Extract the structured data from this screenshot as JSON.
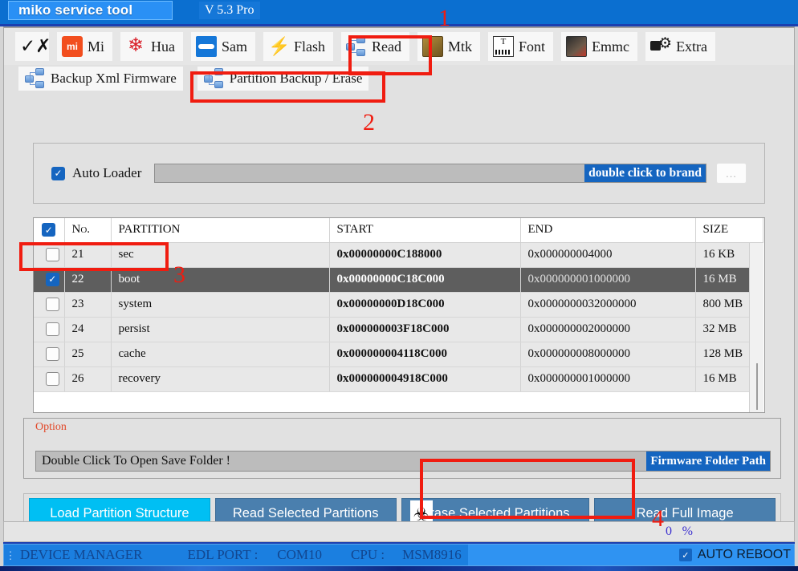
{
  "titlebar": {
    "app_name": "miko service tool",
    "version": "V 5.3 Pro",
    "accent": "#0b6fd0"
  },
  "toolbar": {
    "items": [
      {
        "label": "",
        "icon": "wrench-icon"
      },
      {
        "label": "Mi",
        "icon": "xiaomi-logo-icon"
      },
      {
        "label": "Hua",
        "icon": "huawei-logo-icon"
      },
      {
        "label": "Sam",
        "icon": "samsung-logo-icon"
      },
      {
        "label": "Flash",
        "icon": "lightning-icon"
      },
      {
        "label": "Read",
        "icon": "database-read-icon"
      },
      {
        "label": "Mtk",
        "icon": "mtk-chip-icon"
      },
      {
        "label": "Font",
        "icon": "font-file-icon"
      },
      {
        "label": "Emmc",
        "icon": "emmc-chip-icon"
      },
      {
        "label": "Extra",
        "icon": "extra-tools-icon"
      }
    ],
    "active": "Read"
  },
  "subtabs": {
    "items": [
      {
        "label": "Backup Xml Firmware",
        "icon": "database-icon",
        "active": false
      },
      {
        "label": "Partition Backup / Erase",
        "icon": "database-icon",
        "active": true
      }
    ]
  },
  "loader": {
    "checkbox_label": "Auto Loader",
    "checkbox_checked": true,
    "field_value": "",
    "field_tag": "double click to brand",
    "browse_label": "...",
    "tag_color": "#1565c0"
  },
  "table": {
    "headers": [
      "",
      "No.",
      "PARTITION",
      "START",
      "END",
      "SIZE"
    ],
    "header_checkbox_checked": true,
    "rows": [
      {
        "checked": false,
        "selected": false,
        "no": "21",
        "partition": "sec",
        "start": "0x00000000C188000",
        "end": "0x000000004000",
        "size": "16 KB"
      },
      {
        "checked": true,
        "selected": true,
        "no": "22",
        "partition": "boot",
        "start": "0x00000000C18C000",
        "end": "0x000000001000000",
        "size": "16 MB"
      },
      {
        "checked": false,
        "selected": false,
        "no": "23",
        "partition": "system",
        "start": "0x00000000D18C000",
        "end": "0x0000000032000000",
        "size": "800 MB"
      },
      {
        "checked": false,
        "selected": false,
        "no": "24",
        "partition": "persist",
        "start": "0x000000003F18C000",
        "end": "0x000000002000000",
        "size": "32 MB"
      },
      {
        "checked": false,
        "selected": false,
        "no": "25",
        "partition": "cache",
        "start": "0x000000004118C000",
        "end": "0x000000008000000",
        "size": "128 MB"
      },
      {
        "checked": false,
        "selected": false,
        "no": "26",
        "partition": "recovery",
        "start": "0x000000004918C000",
        "end": "0x000000001000000",
        "size": "16 MB"
      }
    ]
  },
  "option": {
    "legend": "Option",
    "save_text": "Double Click To Open Save Folder !",
    "save_tag": "Firmware Folder Path"
  },
  "buttons": {
    "load_partition_structure": "Load Partition Structure",
    "read_selected_partitions": "Read Selected Partitions",
    "erase_selected_partitions": "Erase Selected Partitions",
    "read_full_image": "Read Full Image",
    "primary_color": "#00bff3",
    "normal_color": "#4a7fae"
  },
  "progress": {
    "value": "0",
    "unit": "%"
  },
  "statusbar": {
    "device_manager": "DEVICE MANAGER",
    "edl_port_label": "EDL PORT :",
    "edl_port_value": "COM10",
    "cpu_label": "CPU :",
    "cpu_value": "MSM8916",
    "auto_reboot_label": "AUTO REBOOT",
    "auto_reboot_checked": true
  },
  "annotations": {
    "n1": "1",
    "n2": "2",
    "n3": "3",
    "n4": "4",
    "color": "#f01c10"
  }
}
